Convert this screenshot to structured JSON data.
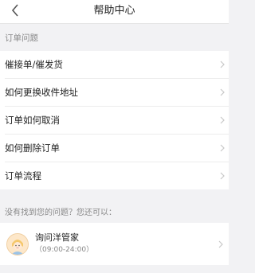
{
  "header": {
    "title": "帮助中心",
    "back_icon": "chevron-left-icon"
  },
  "order_section": {
    "heading": "订单问题",
    "items": [
      {
        "label": "催接单/催发货"
      },
      {
        "label": "如何更换收件地址"
      },
      {
        "label": "订单如何取消"
      },
      {
        "label": "如何删除订单"
      },
      {
        "label": "订单流程"
      }
    ]
  },
  "help": {
    "note": "没有找到您的问题？您还可以：",
    "contact": {
      "name": "询问洋管家",
      "hours": "（09:00-24:00）"
    }
  },
  "colors": {
    "background": "#f2f2f4",
    "row_background": "#ffffff",
    "secondary_text": "#888888",
    "chevron": "#c8c8c8"
  }
}
